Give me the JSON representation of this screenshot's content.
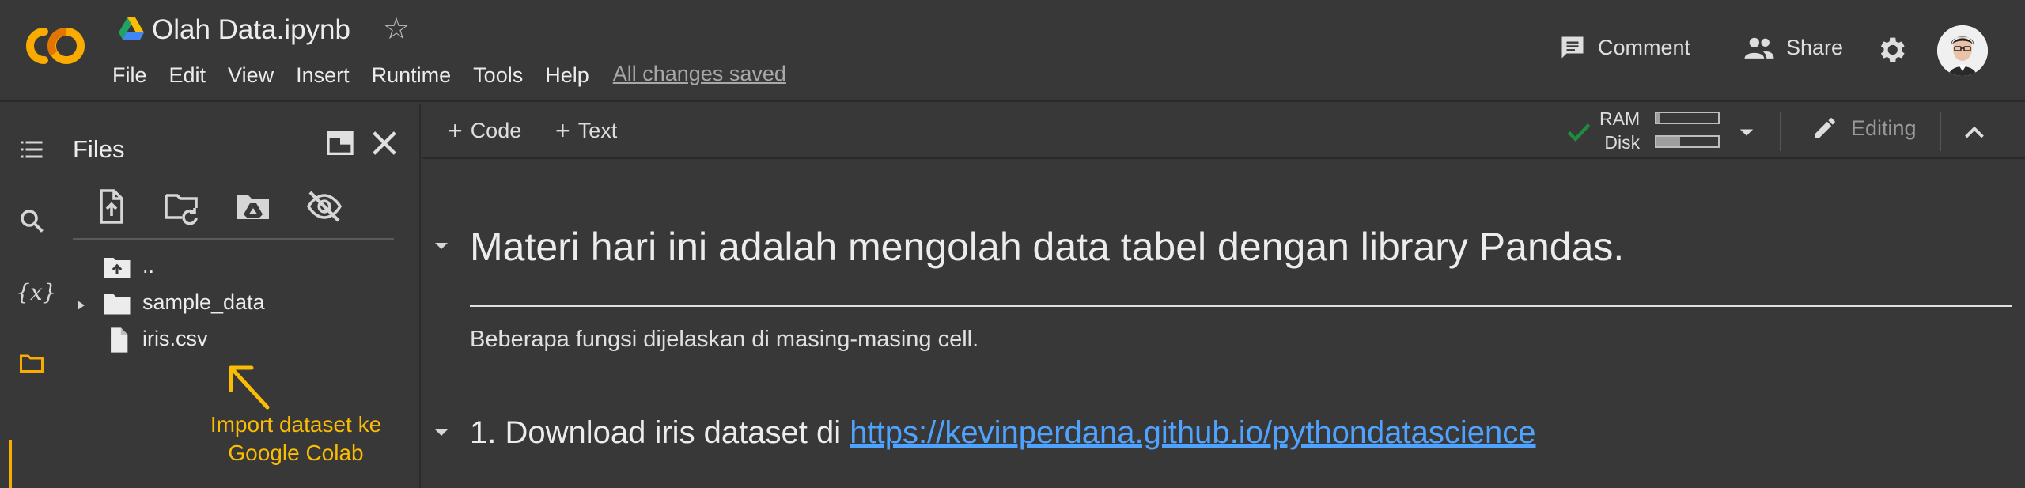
{
  "app": {
    "logo_text": "CO",
    "title": "Olah Data.ipynb",
    "menu": [
      "File",
      "Edit",
      "View",
      "Insert",
      "Runtime",
      "Tools",
      "Help"
    ],
    "save_status": "All changes saved",
    "comment_label": "Comment",
    "share_label": "Share"
  },
  "sidebar": {
    "rail_icons": [
      "table-of-contents-icon",
      "search-icon",
      "variables-icon",
      "files-icon"
    ],
    "variables_glyph": "{x}",
    "active": "files-icon"
  },
  "files_panel": {
    "title": "Files",
    "tree": [
      {
        "name": "..",
        "type": "parent-folder"
      },
      {
        "name": "sample_data",
        "type": "folder",
        "expandable": true
      },
      {
        "name": "iris.csv",
        "type": "file"
      }
    ],
    "annotation": [
      "Import dataset ke",
      "Google Colab"
    ]
  },
  "toolbar": {
    "add_code": "Code",
    "add_text": "Text",
    "ram_label": "RAM",
    "disk_label": "Disk",
    "ram_usage": 0.05,
    "disk_usage": 0.38,
    "editing_label": "Editing"
  },
  "notebook": {
    "heading1": "Materi hari ini adalah mengolah data tabel dengan library Pandas.",
    "paragraph": "Beberapa fungsi dijelaskan di masing-masing cell.",
    "heading2_prefix": "1. Download iris dataset di ",
    "heading2_link": "https://kevinperdana.github.io/pythondatascience"
  },
  "colors": {
    "background": "#383838",
    "accent": "#f9ab00",
    "link": "#4fa3ff",
    "check": "#1e8e3e"
  }
}
